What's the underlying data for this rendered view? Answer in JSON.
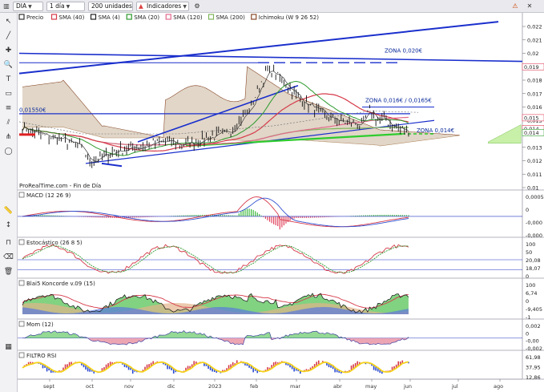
{
  "toolbar": {
    "symbol": "DIA",
    "period": "1 día",
    "units": "200 unidades",
    "indicators": "Indicadores"
  },
  "legend": [
    {
      "label": "Precio",
      "color": "#333333"
    },
    {
      "label": "SMA (40)",
      "color": "#d63b4a"
    },
    {
      "label": "SMA (4)",
      "color": "#222222"
    },
    {
      "label": "SMA (20)",
      "color": "#2e9a2e"
    },
    {
      "label": "SMA (120)",
      "color": "#e26a8c"
    },
    {
      "label": "SMA (200)",
      "color": "#7fb55a"
    },
    {
      "label": "Ichimoku (W 9 26 52)",
      "color": "#8a4a2a"
    }
  ],
  "main": {
    "price_axis": [
      "0,022",
      "0,021",
      "0,02",
      "0,019",
      "0,018",
      "0,017",
      "0,016",
      "0,015",
      "0,014",
      "0,013",
      "0,012",
      "0,011",
      "0,01"
    ],
    "price_axis_tags": [
      {
        "text": "0,019",
        "color": "#e0405a"
      },
      {
        "text": "0,015",
        "color": "#e0405a"
      },
      {
        "text": "0,014",
        "color": "#e0405a"
      },
      {
        "text": "0,014",
        "color": "#2ea02e"
      }
    ],
    "zones": [
      {
        "text": "ZONA 0,020€"
      },
      {
        "text": "ZONA 0,016€ / 0,0165€"
      },
      {
        "text": "ZONA 0,014€"
      },
      {
        "text": "0,01550€"
      }
    ],
    "watermark": "ProRealTime.com - Fin de Día"
  },
  "panels": [
    {
      "title": "MACD (12 26 9)",
      "axis": [
        "0,0005",
        "0",
        "-0,000",
        "-0,000"
      ]
    },
    {
      "title": "Estocástico (26 8 5)",
      "axis": [
        "100",
        "50",
        "20,08",
        "18,07",
        "0"
      ]
    },
    {
      "title": "Blai5 Koncorde v.09 (15)",
      "axis": [
        "100",
        "6,74",
        "0",
        "-9,405",
        "-1"
      ]
    },
    {
      "title": "Mom (12)",
      "axis": [
        "0,002",
        "0",
        "-0,00",
        "-0,002"
      ]
    },
    {
      "title": "FILTRO RSI",
      "axis": [
        "61,98",
        "37,95",
        "12,86"
      ]
    }
  ],
  "x_axis": [
    "sept",
    "oct",
    "nov",
    "dic",
    "2023",
    "feb",
    "mar",
    "abr",
    "may",
    "jun",
    "jul",
    "ago"
  ],
  "icons": {
    "left_tools": [
      "cursor-icon",
      "line-tool-icon",
      "crosshair-icon",
      "zoom-icon",
      "text-icon",
      "rectangle-icon",
      "fibonacci-icon",
      "channel-icon",
      "eraser-icon",
      "trash-icon",
      "magnet-icon"
    ],
    "window": [
      "alert-icon",
      "close-icon"
    ]
  },
  "colors": {
    "price": "#222222",
    "trendline": "#1a2fcc",
    "support": "#2ecc2e",
    "cloud": "#c9b49a",
    "cloud_bull": "#c8f0a8",
    "macd_hist_pos": "#3cb83c",
    "macd_hist_neg": "#e0405a"
  }
}
